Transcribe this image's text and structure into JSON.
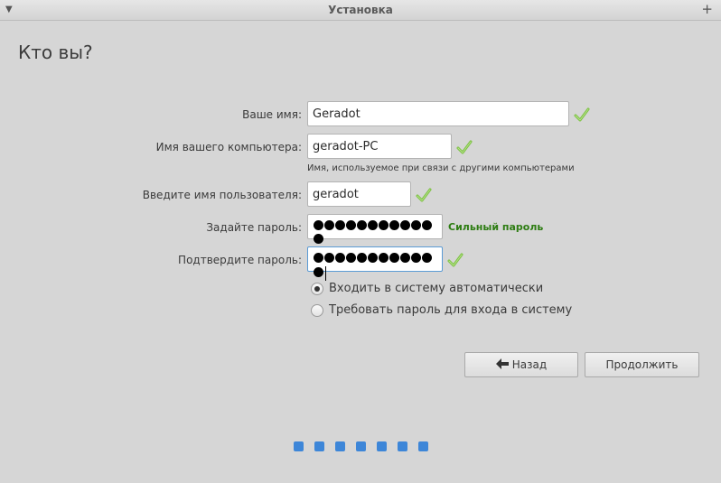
{
  "window": {
    "title": "Установка"
  },
  "page": {
    "heading": "Кто вы?"
  },
  "form": {
    "name_label": "Ваше имя:",
    "name_value": "Geradot",
    "computer_label": "Имя вашего компьютера:",
    "computer_value": "geradot-PC",
    "computer_hint": "Имя, используемое при связи с другими компьютерами",
    "username_label": "Введите имя пользователя:",
    "username_value": "geradot",
    "password_label": "Задайте пароль:",
    "password_strength": "Сильный пароль",
    "confirm_label": "Подтвердите пароль:"
  },
  "login_options": {
    "auto_login": "Входить в систему автоматически",
    "require_password": "Требовать пароль для входа в систему",
    "selected": "auto_login"
  },
  "buttons": {
    "back": "Назад",
    "continue": "Продолжить"
  },
  "icons": {
    "valid": "checkmark-icon",
    "back": "arrow-left-icon"
  },
  "colors": {
    "valid_check": "#7cc142",
    "strength_text": "#2e7d13",
    "progress_dot": "#3d86d8"
  }
}
